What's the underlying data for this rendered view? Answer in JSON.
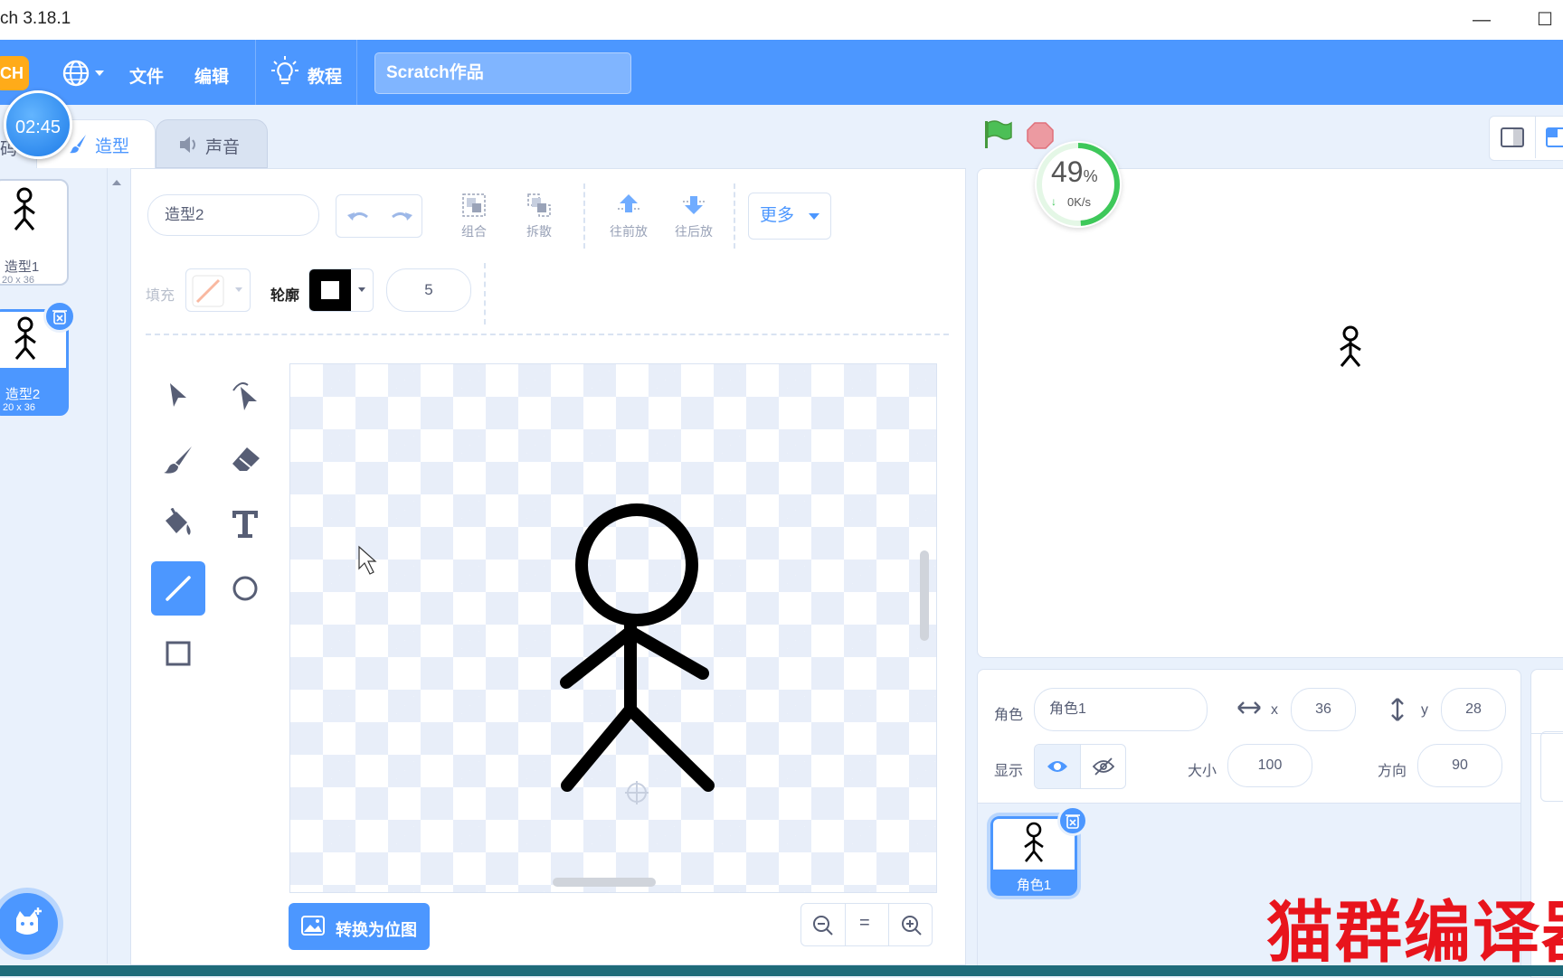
{
  "window": {
    "title": "ch 3.18.1"
  },
  "menubar": {
    "logo": "CH",
    "file": "文件",
    "edit": "编辑",
    "tutorials": "教程",
    "project_title": "Scratch作品"
  },
  "timer": {
    "text": "02:45"
  },
  "tabs": {
    "costumes": "造型",
    "sounds": "声音",
    "code_partial": "码"
  },
  "costumes": [
    {
      "name": "造型1",
      "size": "20 x 36"
    },
    {
      "name": "造型2",
      "size": "20 x 36",
      "selected": true
    }
  ],
  "editor": {
    "costume_name": "造型2",
    "group": "组合",
    "ungroup": "拆散",
    "forward": "往前放",
    "backward": "往后放",
    "more": "更多",
    "fill_label": "填充",
    "outline_label": "轮廓",
    "outline_width": "5",
    "convert_bitmap": "转换为位图",
    "zoom_reset": "="
  },
  "network": {
    "percent": "49",
    "percent_sign": "%",
    "speed": "0K/s"
  },
  "sprite": {
    "label_sprite": "角色",
    "name": "角色1",
    "label_x": "x",
    "x": "36",
    "label_y": "y",
    "y": "28",
    "label_show": "显示",
    "label_size": "大小",
    "size": "100",
    "label_direction": "方向",
    "direction": "90",
    "thumb_name": "角色1"
  },
  "watermark": "猫群编译器",
  "colors": {
    "accent": "#4c97ff",
    "menubar": "#4c97ff",
    "watermark": "#e8141c",
    "flag": "#4cbf56"
  }
}
